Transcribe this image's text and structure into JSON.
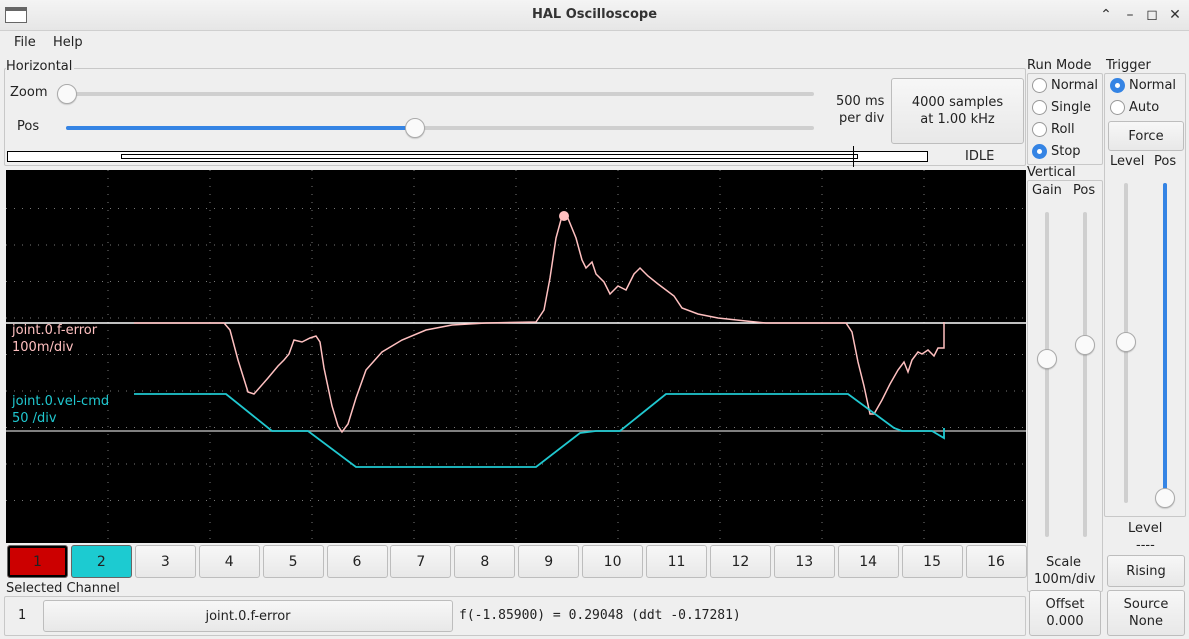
{
  "window": {
    "title": "HAL Oscilloscope"
  },
  "menu": {
    "file": "File",
    "help": "Help"
  },
  "horizontal": {
    "title": "Horizontal",
    "zoom_label": "Zoom",
    "pos_label": "Pos",
    "zoom_value": 0,
    "pos_value": 0.47,
    "rate_line1": "500 ms",
    "rate_line2": "per div",
    "samples_line1": "4000 samples",
    "samples_line2": "at 1.00 kHz",
    "status": "IDLE"
  },
  "run_mode": {
    "title": "Run Mode",
    "options": [
      "Normal",
      "Single",
      "Roll",
      "Stop"
    ],
    "selected": "Stop"
  },
  "trigger": {
    "title": "Trigger",
    "options": [
      "Normal",
      "Auto"
    ],
    "selected": "Normal",
    "force": "Force",
    "level_label": "Level",
    "pos_label": "Pos",
    "level_value_label": "Level",
    "level_value": "----",
    "edge": "Rising",
    "source_line1": "Source",
    "source_line2": "None"
  },
  "vertical": {
    "title": "Vertical",
    "gain_label": "Gain",
    "pos_label": "Pos",
    "scale_label": "Scale",
    "scale_value": "100m/div",
    "offset_label": "Offset",
    "offset_value": "0.000"
  },
  "traces": [
    {
      "name": "joint.0.f-error",
      "scale": "100m/div",
      "color": "#ffc0c0"
    },
    {
      "name": "joint.0.vel-cmd",
      "scale": "50 /div",
      "color": "#20c8d0"
    }
  ],
  "channels": [
    "1",
    "2",
    "3",
    "4",
    "5",
    "6",
    "7",
    "8",
    "9",
    "10",
    "11",
    "12",
    "13",
    "14",
    "15",
    "16"
  ],
  "channel_colors": {
    "1": "#cc0000",
    "2": "#1ccbd1"
  },
  "selected_channel": {
    "title": "Selected Channel",
    "number": "1",
    "name": "joint.0.f-error",
    "readout": "f(-1.85900) =  0.29048 (ddt -0.17281)"
  }
}
